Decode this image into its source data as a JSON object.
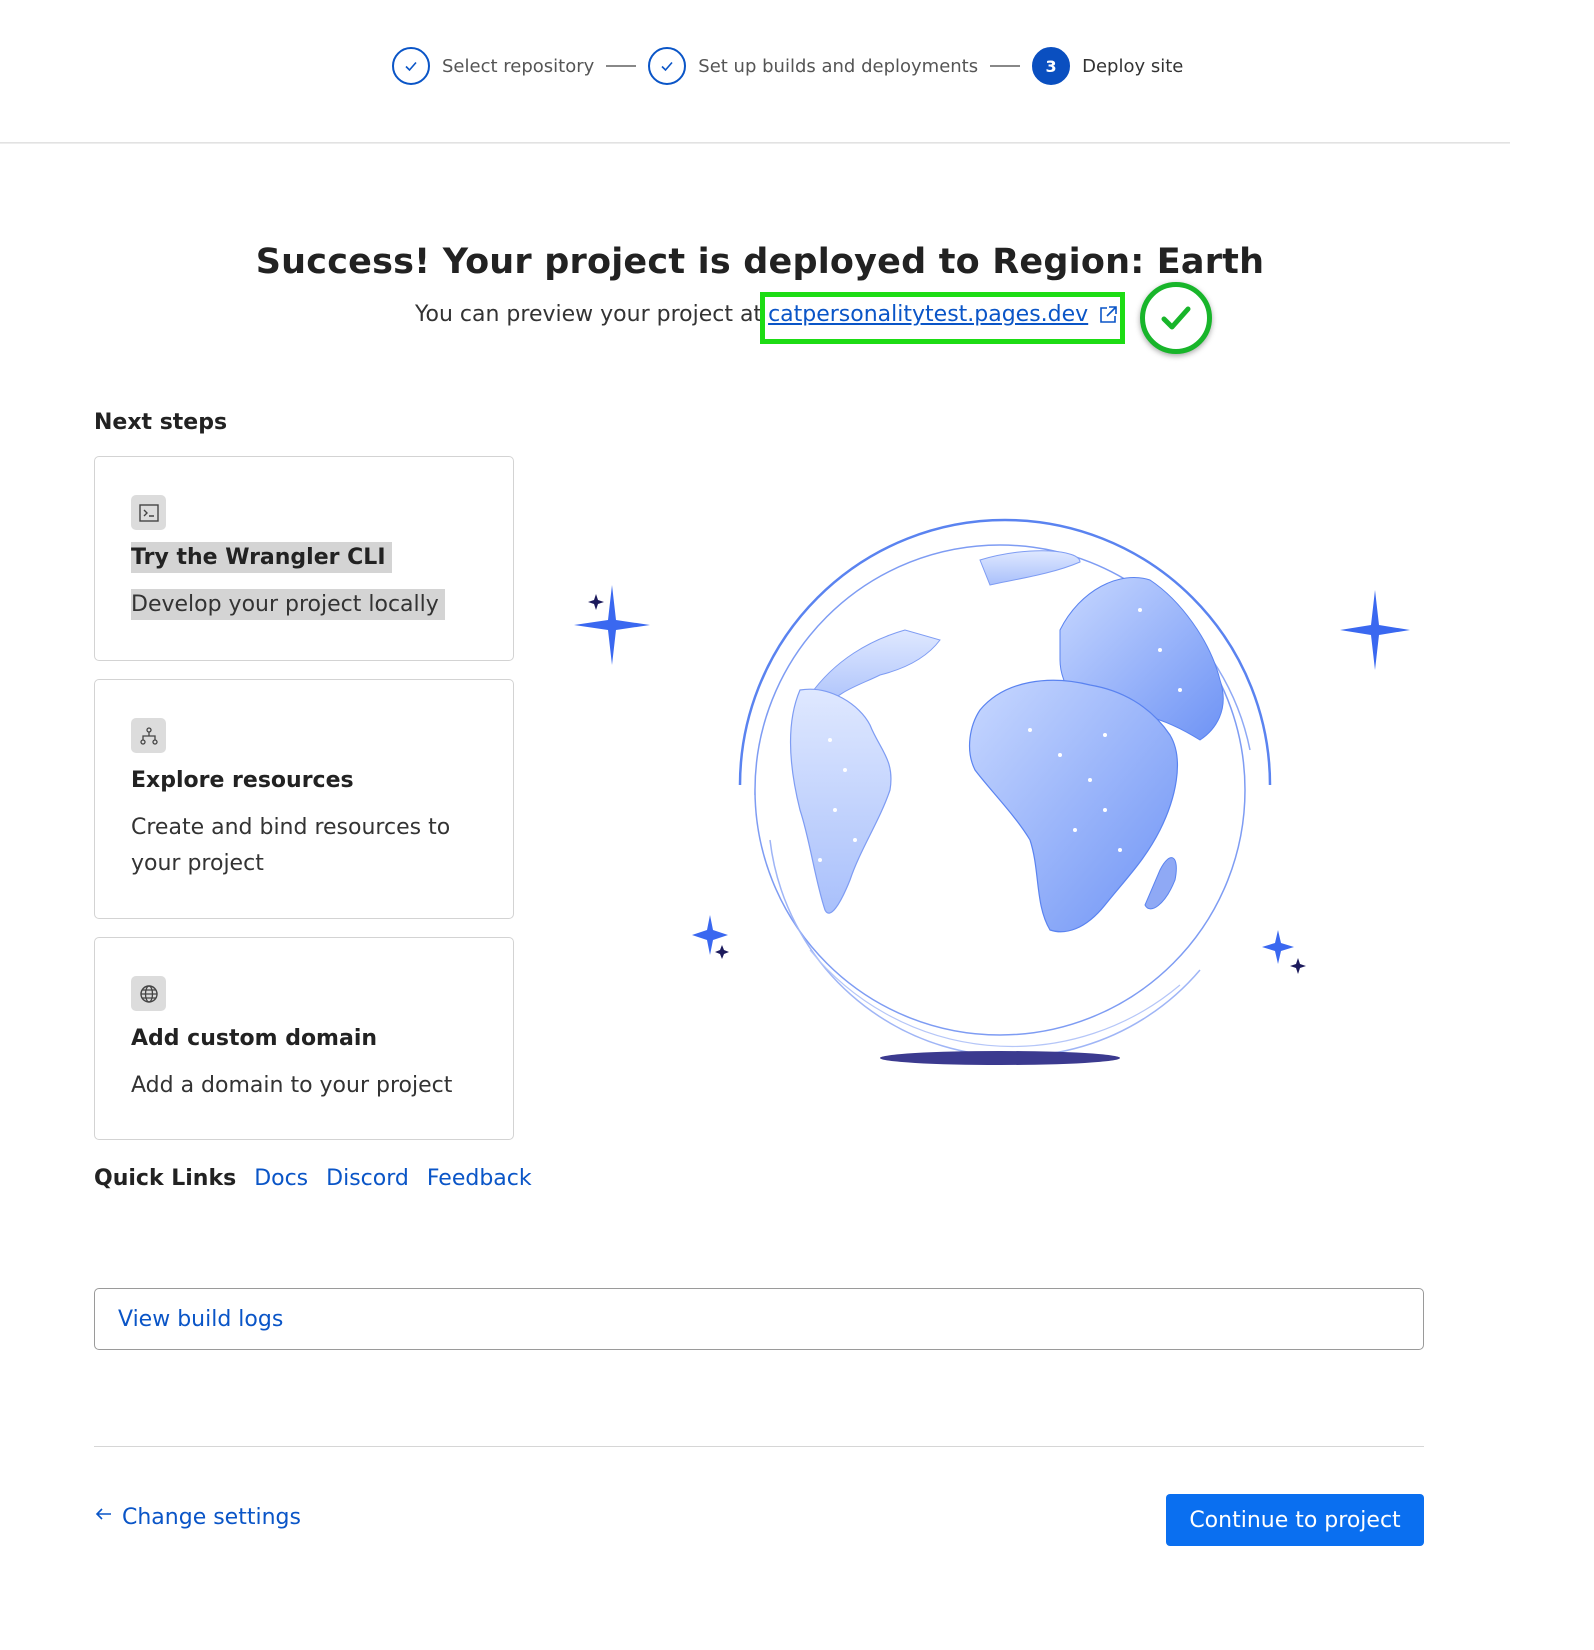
{
  "stepper": {
    "steps": [
      {
        "label": "Select repository",
        "state": "done"
      },
      {
        "label": "Set up builds and deployments",
        "state": "done"
      },
      {
        "label": "Deploy site",
        "state": "active",
        "number": "3"
      }
    ]
  },
  "success": {
    "title": "Success! Your project is deployed to Region: Earth",
    "subtitle_prefix": "You can preview your project at",
    "preview_link": "catpersonalitytest.pages.dev"
  },
  "next_steps": {
    "heading": "Next steps",
    "cards": [
      {
        "icon": "terminal-icon",
        "title": "Try the Wrangler CLI",
        "desc": "Develop your project locally"
      },
      {
        "icon": "network-icon",
        "title": "Explore resources",
        "desc": "Create and bind resources to your project"
      },
      {
        "icon": "globe-icon",
        "title": "Add custom domain",
        "desc": "Add a domain to your project"
      }
    ]
  },
  "quick_links": {
    "label": "Quick Links",
    "links": [
      "Docs",
      "Discord",
      "Feedback"
    ]
  },
  "build_logs": {
    "label": "View build logs"
  },
  "footer": {
    "change_settings": "Change settings",
    "continue": "Continue to project"
  },
  "colors": {
    "accent": "#0a55c7",
    "button": "#0a6ff0",
    "highlight": "#1ddc14",
    "check": "#18b52a"
  }
}
